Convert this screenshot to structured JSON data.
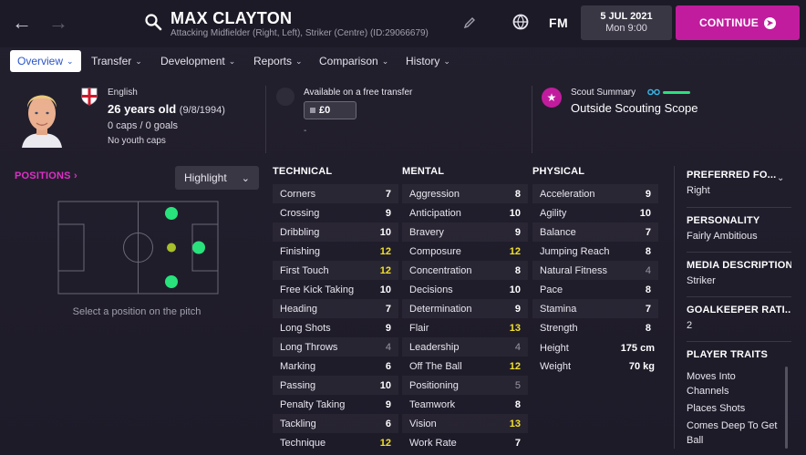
{
  "header": {
    "player_name": "MAX CLAYTON",
    "player_sub": "Attacking Midfielder (Right, Left), Striker (Centre) (ID:29066679)",
    "logo": "FM",
    "date_main": "5 JUL 2021",
    "date_sub": "Mon 9:00",
    "continue_label": "CONTINUE"
  },
  "tabs": [
    {
      "label": "Overview",
      "active": true
    },
    {
      "label": "Transfer"
    },
    {
      "label": "Development"
    },
    {
      "label": "Reports"
    },
    {
      "label": "Comparison"
    },
    {
      "label": "History"
    }
  ],
  "summary": {
    "nationality": "English",
    "age": "26 years old",
    "dob": "(9/8/1994)",
    "caps": "0 caps / 0 goals",
    "youth": "No youth caps",
    "transfer_label": "Available on a free transfer",
    "transfer_value": "£0",
    "transfer_dash": "-",
    "scout_label": "Scout Summary",
    "scout_value": "Outside Scouting Scope"
  },
  "positions": {
    "title": "POSITIONS",
    "highlight_label": "Highlight",
    "hint": "Select a position on the pitch"
  },
  "technical": {
    "title": "TECHNICAL",
    "rows": [
      {
        "name": "Corners",
        "value": "7"
      },
      {
        "name": "Crossing",
        "value": "9"
      },
      {
        "name": "Dribbling",
        "value": "10"
      },
      {
        "name": "Finishing",
        "value": "12"
      },
      {
        "name": "First Touch",
        "value": "12"
      },
      {
        "name": "Free Kick Taking",
        "value": "10"
      },
      {
        "name": "Heading",
        "value": "7"
      },
      {
        "name": "Long Shots",
        "value": "9"
      },
      {
        "name": "Long Throws",
        "value": "4"
      },
      {
        "name": "Marking",
        "value": "6"
      },
      {
        "name": "Passing",
        "value": "10"
      },
      {
        "name": "Penalty Taking",
        "value": "9"
      },
      {
        "name": "Tackling",
        "value": "6"
      },
      {
        "name": "Technique",
        "value": "12"
      }
    ]
  },
  "mental": {
    "title": "MENTAL",
    "rows": [
      {
        "name": "Aggression",
        "value": "8"
      },
      {
        "name": "Anticipation",
        "value": "10"
      },
      {
        "name": "Bravery",
        "value": "9"
      },
      {
        "name": "Composure",
        "value": "12"
      },
      {
        "name": "Concentration",
        "value": "8"
      },
      {
        "name": "Decisions",
        "value": "10"
      },
      {
        "name": "Determination",
        "value": "9"
      },
      {
        "name": "Flair",
        "value": "13"
      },
      {
        "name": "Leadership",
        "value": "4"
      },
      {
        "name": "Off The Ball",
        "value": "12"
      },
      {
        "name": "Positioning",
        "value": "5"
      },
      {
        "name": "Teamwork",
        "value": "8"
      },
      {
        "name": "Vision",
        "value": "13"
      },
      {
        "name": "Work Rate",
        "value": "7"
      }
    ]
  },
  "physical": {
    "title": "PHYSICAL",
    "rows": [
      {
        "name": "Acceleration",
        "value": "9"
      },
      {
        "name": "Agility",
        "value": "10"
      },
      {
        "name": "Balance",
        "value": "7"
      },
      {
        "name": "Jumping Reach",
        "value": "8"
      },
      {
        "name": "Natural Fitness",
        "value": "4"
      },
      {
        "name": "Pace",
        "value": "8"
      },
      {
        "name": "Stamina",
        "value": "7"
      },
      {
        "name": "Strength",
        "value": "8"
      }
    ],
    "height_label": "Height",
    "height_value": "175 cm",
    "weight_label": "Weight",
    "weight_value": "70 kg"
  },
  "info": {
    "foot_head": "PREFERRED FO...",
    "foot_value": "Right",
    "personality_head": "PERSONALITY",
    "personality_value": "Fairly Ambitious",
    "media_head": "MEDIA DESCRIPTION",
    "media_value": "Striker",
    "gk_head": "GOALKEEPER RATI...",
    "gk_value": "2",
    "traits_head": "PLAYER TRAITS",
    "traits": [
      "Moves Into Channels",
      "Places Shots",
      "Comes Deep To Get Ball"
    ]
  },
  "colors": {
    "accent": "#c21c9e",
    "highlight_value": "#f1e02b",
    "low_value": "#9a97a5",
    "position_natural": "#29e27c",
    "position_secondary": "#a6bf2a"
  }
}
